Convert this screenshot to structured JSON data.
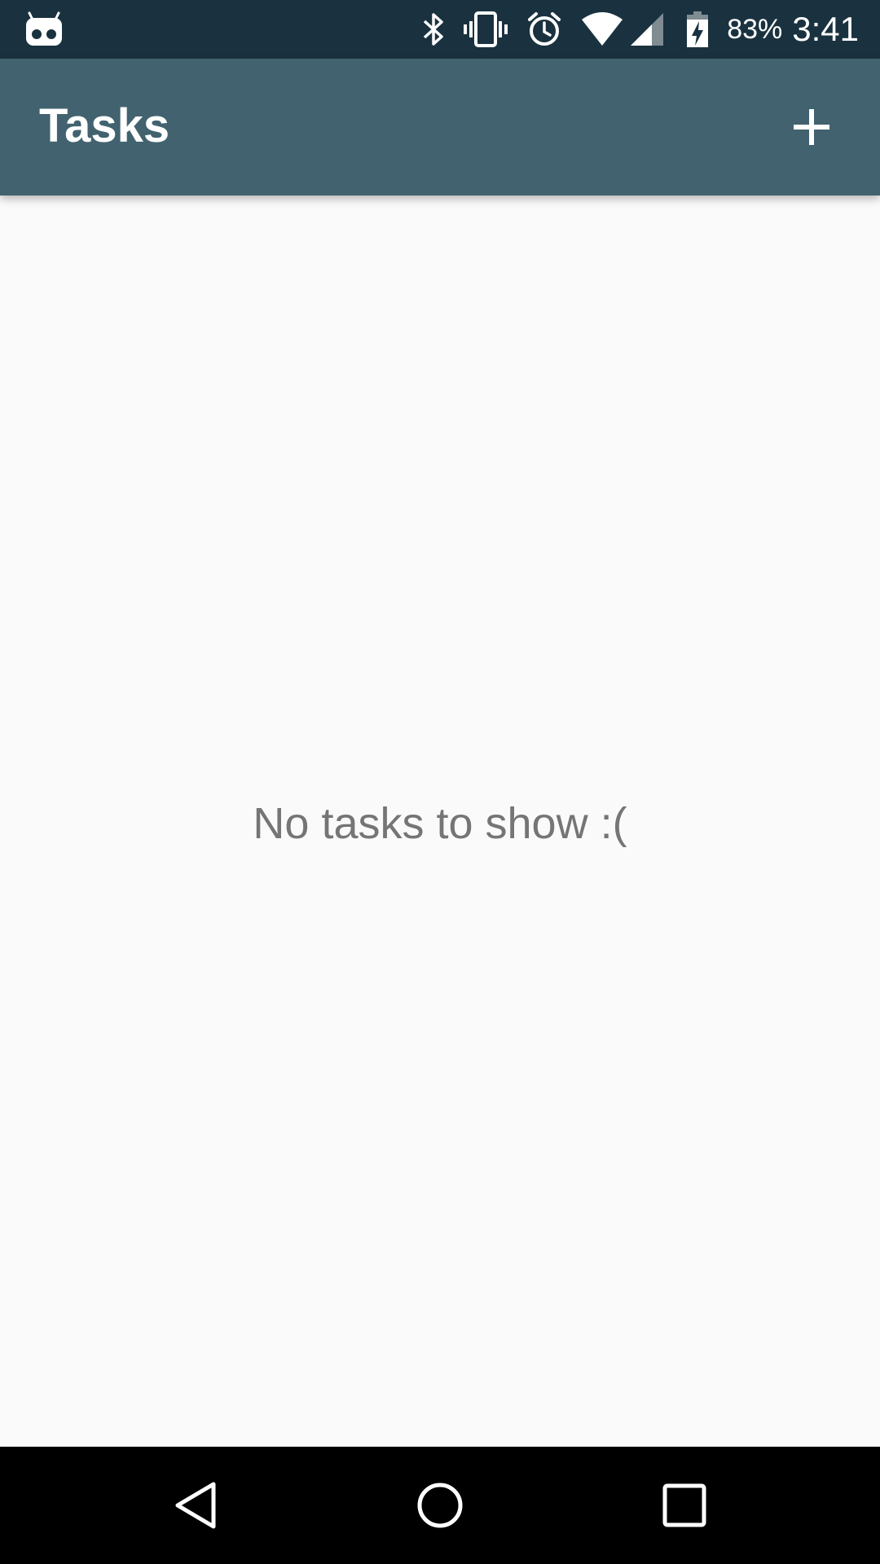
{
  "status_bar": {
    "battery_percent": "83%",
    "time": "3:41",
    "icons": [
      "cyanogen-bot-icon",
      "bluetooth-icon",
      "vibrate-icon",
      "alarm-icon",
      "wifi-icon",
      "cell-signal-icon",
      "battery-charging-icon"
    ]
  },
  "app_bar": {
    "title": "Tasks",
    "add_icon": "plus-icon"
  },
  "content": {
    "empty_message": "No tasks to show :("
  },
  "nav_bar": {
    "icons": [
      "back-icon",
      "home-icon",
      "recents-icon"
    ]
  },
  "colors": {
    "status_bar": "#1a323f",
    "app_bar": "#42626f",
    "background": "#fafafa",
    "empty_text": "#757575",
    "nav_bar": "#000000"
  }
}
